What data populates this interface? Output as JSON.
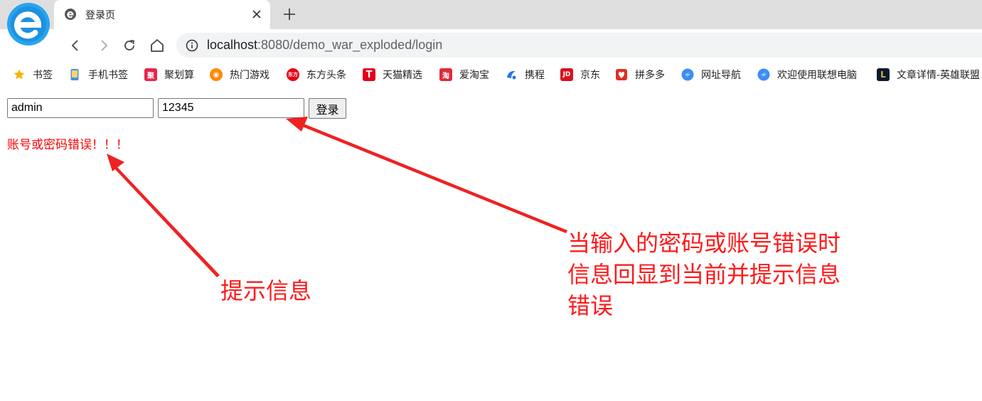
{
  "browser": {
    "tab": {
      "title": "登录页"
    },
    "address_bar": {
      "url_host": "localhost",
      "url_rest": ":8080/demo_war_exploded/login"
    },
    "bookmarks": [
      {
        "label": "书签",
        "icon": "star-icon"
      },
      {
        "label": "手机书签",
        "icon": "phone-icon"
      },
      {
        "label": "聚划算",
        "icon": "juhuasuan-icon",
        "badge": "聚",
        "color": "#e5264c"
      },
      {
        "label": "热门游戏",
        "icon": "game-icon",
        "color": "#ff8a00"
      },
      {
        "label": "东方头条",
        "icon": "dongfang-icon",
        "badge": "东方",
        "color": "#e60012"
      },
      {
        "label": "天猫精选",
        "icon": "tmall-icon",
        "badge": "T",
        "color": "#e5001a"
      },
      {
        "label": "爱淘宝",
        "icon": "aitaobao-icon",
        "badge": "淘",
        "color": "#e02a3a"
      },
      {
        "label": "携程",
        "icon": "ctrip-icon",
        "color": "#2577e3"
      },
      {
        "label": "京东",
        "icon": "jd-icon",
        "badge": "JD",
        "color": "#d7141d"
      },
      {
        "label": "拼多多",
        "icon": "pinduoduo-icon",
        "color": "#e02e24"
      },
      {
        "label": "网址导航",
        "icon": "nav-site-icon",
        "color": "#3d8df5"
      },
      {
        "label": "欢迎使用联想电脑",
        "icon": "lenovo-site-icon",
        "color": "#3d8df5"
      },
      {
        "label": "文章详情-英雄联盟",
        "icon": "lol-icon",
        "badge": "L",
        "color": "#0a1a2e"
      }
    ]
  },
  "form": {
    "username_value": "admin",
    "password_value": "12345",
    "submit_label": "登录"
  },
  "error_message": "账号或密码错误！！！",
  "annotations": {
    "left_note": "提示信息",
    "right_note_lines": [
      "当输入的密码或账号错误时",
      "信息回显到当前并提示信息",
      "错误"
    ]
  },
  "colors": {
    "error": "#ff0000",
    "annotation": "#ff1a1a"
  }
}
